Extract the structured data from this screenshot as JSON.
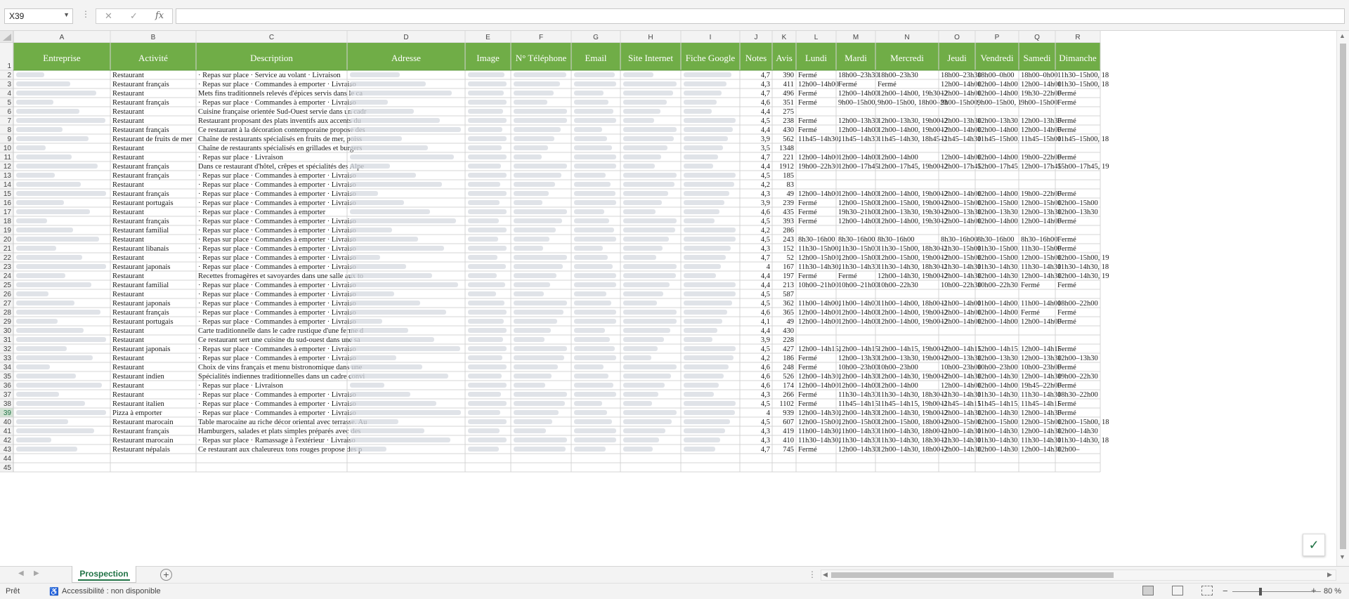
{
  "formula_bar": {
    "cell_ref": "X39",
    "formula": ""
  },
  "sheet": {
    "column_letters": [
      "A",
      "B",
      "C",
      "D",
      "E",
      "F",
      "G",
      "H",
      "I",
      "J",
      "K",
      "L",
      "M",
      "N",
      "O",
      "P",
      "Q",
      "R"
    ],
    "headers": [
      "Entreprise",
      "Activité",
      "Description",
      "Adresse",
      "Image",
      "N° Téléphone",
      "Email",
      "Site Internet",
      "Fiche Google",
      "Notes",
      "Avis",
      "Lundi",
      "Mardi",
      "Mercredi",
      "Jeudi",
      "Vendredi",
      "Samedi",
      "Dimanche"
    ],
    "header_fill": "#70ad47",
    "header_text_color": "#ffffff",
    "grid_color": "#d4d4d4",
    "row_heading_fill": "#f3f3f3",
    "selected_row": "39",
    "blurred_columns": [
      "A",
      "D",
      "E",
      "F",
      "G",
      "H",
      "I"
    ],
    "rows": [
      {
        "n": "2",
        "b": "Restaurant",
        "c": "·  Repas sur place  ·  Service au volant  ·  Livraison",
        "j": "4,7",
        "k": "390",
        "l": "Fermé",
        "m": "18h00–23h30",
        "nn": "18h00–23h30",
        "o": "18h00–23h30",
        "p": "18h00–0h00",
        "q": "18h00–0h00",
        "r": "11h30–15h00, 18"
      },
      {
        "n": "3",
        "b": "Restaurant français",
        "c": "·  Repas sur place  ·  Commandes à emporter  ·  Livraiso",
        "j": "4,3",
        "k": "411",
        "l": "12h00–14h00",
        "m": "Fermé",
        "nn": "Fermé",
        "o": "12h00–14h00",
        "p": "12h00–14h00",
        "q": "12h00–14h00",
        "r": "11h30–15h00, 18"
      },
      {
        "n": "4",
        "b": "Restaurant",
        "c": "Mets fins traditionnels relevés d'épices servis dans le ca",
        "j": "4,7",
        "k": "496",
        "l": "Fermé",
        "m": "12h00–14h00",
        "nn": "12h00–14h00, 19h30–2",
        "o": "12h00–14h00",
        "p": "12h00–14h00,",
        "q": "19h30–22h00",
        "r": "Fermé"
      },
      {
        "n": "5",
        "b": "Restaurant français",
        "c": "·  Repas sur place  ·  Commandes à emporter  ·  Livraiso",
        "j": "4,6",
        "k": "351",
        "l": "Fermé",
        "m": "9h00–15h00,",
        "nn": "9h00–15h00, 18h00–23",
        "o": "9h00–15h00,",
        "p": "9h00–15h00, 1",
        "q": "9h00–15h00",
        "r": "Fermé"
      },
      {
        "n": "6",
        "b": "Restaurant",
        "c": "Cuisine française orientée Sud-Ouest servie dans un cadr",
        "j": "4,4",
        "k": "275",
        "l": "",
        "m": "",
        "nn": "",
        "o": "",
        "p": "",
        "q": "",
        "r": ""
      },
      {
        "n": "7",
        "b": "Restaurant",
        "c": "Restaurant proposant des plats inventifs aux accents du",
        "j": "4,5",
        "k": "238",
        "l": "Fermé",
        "m": "12h00–13h30",
        "nn": "12h00–13h30, 19h00–2",
        "o": "12h00–13h30",
        "p": "12h00–13h30,",
        "q": "12h00–13h30",
        "r": "Fermé"
      },
      {
        "n": "8",
        "b": "Restaurant français",
        "c": "Ce restaurant à la décoration contemporaine propose des",
        "j": "4,4",
        "k": "430",
        "l": "Fermé",
        "m": "12h00–14h00",
        "nn": "12h00–14h00, 19h00–2",
        "o": "12h00–14h00",
        "p": "12h00–14h00,",
        "q": "12h00–14h00",
        "r": "Fermé"
      },
      {
        "n": "9",
        "b": "Restaurant de fruits de mer",
        "c": "Chaîne de restaurants spécialisés en fruits de mer, poiss",
        "j": "3,9",
        "k": "562",
        "l": "11h45–14h30,",
        "m": "11h45–14h30",
        "nn": "11h45–14h30, 18h45–2",
        "o": "11h45–14h30",
        "p": "11h45–15h00,",
        "q": "11h45–15h00",
        "r": "11h45–15h00, 18"
      },
      {
        "n": "10",
        "b": "Restaurant",
        "c": "Chaîne de restaurants spécialisés en grillades et burgers",
        "j": "3,5",
        "k": "1348",
        "l": "",
        "m": "",
        "nn": "",
        "o": "",
        "p": "",
        "q": "",
        "r": ""
      },
      {
        "n": "11",
        "b": "Restaurant",
        "c": "·  Repas sur place  ·  Livraison",
        "j": "4,7",
        "k": "221",
        "l": "12h00–14h00",
        "m": "12h00–14h00",
        "nn": "12h00–14h00",
        "o": "12h00–14h00",
        "p": "12h00–14h00,",
        "q": "19h00–22h00",
        "r": "Fermé"
      },
      {
        "n": "12",
        "b": "Restaurant français",
        "c": "Dans ce restaurant d'hôtel, crêpes et spécialités des Alpe",
        "j": "4,4",
        "k": "1912",
        "l": "19h00–22h30",
        "m": "12h00–17h45",
        "nn": "12h00–17h45, 19h00–2",
        "o": "12h00–17h45",
        "p": "12h00–17h45,",
        "q": "12h00–17h45",
        "r": "15h00–17h45, 19"
      },
      {
        "n": "13",
        "b": "Restaurant français",
        "c": "·  Repas sur place  ·  Commandes à emporter  ·  Livraiso",
        "j": "4,5",
        "k": "185",
        "l": "",
        "m": "",
        "nn": "",
        "o": "",
        "p": "",
        "q": "",
        "r": ""
      },
      {
        "n": "14",
        "b": "Restaurant",
        "c": "·  Repas sur place  ·  Commandes à emporter  ·  Livraiso",
        "j": "4,2",
        "k": "83",
        "l": "",
        "m": "",
        "nn": "",
        "o": "",
        "p": "",
        "q": "",
        "r": ""
      },
      {
        "n": "15",
        "b": "Restaurant français",
        "c": "·  Repas sur place  ·  Commandes à emporter  ·  Livraiso",
        "j": "4,3",
        "k": "49",
        "l": "12h00–14h00",
        "m": "12h00–14h00",
        "nn": "12h00–14h00, 19h00–2",
        "o": "12h00–14h00",
        "p": "12h00–14h00,",
        "q": "19h00–22h00",
        "r": "Fermé"
      },
      {
        "n": "16",
        "b": "Restaurant portugais",
        "c": "·  Repas sur place  ·  Commandes à emporter  ·  Livraiso",
        "j": "3,9",
        "k": "239",
        "l": "Fermé",
        "m": "12h00–15h00",
        "nn": "12h00–15h00, 19h00–2",
        "o": "12h00–15h00",
        "p": "12h00–15h00,",
        "q": "12h00–15h00",
        "r": "12h00–15h00"
      },
      {
        "n": "17",
        "b": "Restaurant",
        "c": "·  Repas sur place  ·  Commandes à emporter",
        "j": "4,6",
        "k": "435",
        "l": "Fermé",
        "m": "19h30–21h00",
        "nn": "12h00–13h30, 19h30–2",
        "o": "12h00–13h30",
        "p": "12h00–13h30,",
        "q": "12h00–13h30",
        "r": "12h00–13h30"
      },
      {
        "n": "18",
        "b": "Restaurant français",
        "c": "·  Repas sur place  ·  Commandes à emporter  ·  Livraiso",
        "j": "4,5",
        "k": "393",
        "l": "Fermé",
        "m": "12h00–14h00",
        "nn": "12h00–14h00, 19h30–2",
        "o": "12h00–14h00",
        "p": "12h00–14h00,",
        "q": "12h00–14h00",
        "r": "Fermé"
      },
      {
        "n": "19",
        "b": "Restaurant familial",
        "c": "·  Repas sur place  ·  Commandes à emporter  ·  Livraiso",
        "j": "4,2",
        "k": "286",
        "l": "",
        "m": "",
        "nn": "",
        "o": "",
        "p": "",
        "q": "",
        "r": ""
      },
      {
        "n": "20",
        "b": "Restaurant",
        "c": "·  Repas sur place  ·  Commandes à emporter  ·  Livraiso",
        "j": "4,5",
        "k": "243",
        "l": "8h30–16h00",
        "m": "8h30–16h00",
        "nn": "8h30–16h00",
        "o": "8h30–16h00",
        "p": "8h30–16h00",
        "q": "8h30–16h00",
        "r": "Fermé"
      },
      {
        "n": "21",
        "b": "Restaurant libanais",
        "c": "·  Repas sur place  ·  Commandes à emporter  ·  Livraiso",
        "j": "4,3",
        "k": "152",
        "l": "11h30–15h00,",
        "m": "11h30–15h00",
        "nn": "11h30–15h00, 18h30–2",
        "o": "11h30–15h00",
        "p": "11h30–15h00,",
        "q": "11h30–15h00",
        "r": "Fermé"
      },
      {
        "n": "22",
        "b": "Restaurant",
        "c": "·  Repas sur place  ·  Commandes à emporter  ·  Livraiso",
        "j": "4,7",
        "k": "52",
        "l": "12h00–15h00,",
        "m": "12h00–15h00",
        "nn": "12h00–15h00, 19h00–2",
        "o": "12h00–15h00",
        "p": "12h00–15h00,",
        "q": "12h00–15h00",
        "r": "12h00–15h00, 19"
      },
      {
        "n": "23",
        "b": "Restaurant japonais",
        "c": "·  Repas sur place  ·  Commandes à emporter  ·  Livraiso",
        "j": "4",
        "k": "167",
        "l": "11h30–14h30,",
        "m": "11h30–14h30",
        "nn": "11h30–14h30, 18h30–2",
        "o": "11h30–14h30",
        "p": "11h30–14h30,",
        "q": "11h30–14h30",
        "r": "11h30–14h30, 18"
      },
      {
        "n": "24",
        "b": "Restaurant",
        "c": "Recettes fromagères et savoyardes dans une salle aux to",
        "j": "4,4",
        "k": "197",
        "l": "Fermé",
        "m": "Fermé",
        "nn": "12h00–14h30, 19h00–2",
        "o": "12h00–14h30",
        "p": "12h00–14h30,",
        "q": "12h00–14h30",
        "r": "12h00–14h30, 19"
      },
      {
        "n": "25",
        "b": "Restaurant familial",
        "c": "·  Repas sur place  ·  Commandes à emporter  ·  Livraiso",
        "j": "4,4",
        "k": "213",
        "l": "10h00–21h00",
        "m": "10h00–21h00",
        "nn": "10h00–22h30",
        "o": "10h00–22h30",
        "p": "10h00–22h30",
        "q": "Fermé",
        "r": "Fermé"
      },
      {
        "n": "26",
        "b": "Restaurant",
        "c": "·  Repas sur place  ·  Commandes à emporter  ·  Livraiso",
        "j": "4,5",
        "k": "587",
        "l": "",
        "m": "",
        "nn": "",
        "o": "",
        "p": "",
        "q": "",
        "r": ""
      },
      {
        "n": "27",
        "b": "Restaurant japonais",
        "c": "·  Repas sur place  ·  Commandes à emporter  ·  Livraiso",
        "j": "4,5",
        "k": "362",
        "l": "11h00–14h00,",
        "m": "11h00–14h00",
        "nn": "11h00–14h00, 18h00–2",
        "o": "11h00–14h00",
        "p": "11h00–14h00,",
        "q": "11h00–14h00",
        "r": "18h00–22h00"
      },
      {
        "n": "28",
        "b": "Restaurant français",
        "c": "·  Repas sur place  ·  Commandes à emporter  ·  Livraiso",
        "j": "4,6",
        "k": "365",
        "l": "12h00–14h00",
        "m": "12h00–14h00",
        "nn": "12h00–14h00, 19h00–2",
        "o": "12h00–14h00",
        "p": "12h00–14h00,",
        "q": "Fermé",
        "r": "Fermé"
      },
      {
        "n": "29",
        "b": "Restaurant portugais",
        "c": "·  Repas sur place  ·  Commandes à emporter  ·  Livraiso",
        "j": "4,1",
        "k": "49",
        "l": "12h00–14h00",
        "m": "12h00–14h00",
        "nn": "12h00–14h00, 19h00–2",
        "o": "12h00–14h00",
        "p": "12h00–14h00,",
        "q": "12h00–14h00",
        "r": "Fermé"
      },
      {
        "n": "30",
        "b": "Restaurant",
        "c": "Carte traditionnelle dans le cadre rustique d'une ferme d",
        "j": "4,4",
        "k": "430",
        "l": "",
        "m": "",
        "nn": "",
        "o": "",
        "p": "",
        "q": "",
        "r": ""
      },
      {
        "n": "31",
        "b": "Restaurant",
        "c": "Ce restaurant sert une cuisine du sud-ouest dans une sa",
        "j": "3,9",
        "k": "228",
        "l": "",
        "m": "",
        "nn": "",
        "o": "",
        "p": "",
        "q": "",
        "r": ""
      },
      {
        "n": "32",
        "b": "Restaurant japonais",
        "c": "·  Repas sur place  ·  Commandes à emporter  ·  Livraiso",
        "j": "4,5",
        "k": "427",
        "l": "12h00–14h15,",
        "m": "12h00–14h15",
        "nn": "12h00–14h15, 19h00–2",
        "o": "12h00–14h15",
        "p": "12h00–14h15,",
        "q": "12h00–14h15",
        "r": "Fermé"
      },
      {
        "n": "33",
        "b": "Restaurant",
        "c": "·  Repas sur place  ·  Commandes à emporter  ·  Livraiso",
        "j": "4,2",
        "k": "186",
        "l": "Fermé",
        "m": "12h00–13h30",
        "nn": "12h00–13h30, 19h00–2",
        "o": "12h00–13h30",
        "p": "12h00–13h30,",
        "q": "12h00–13h30",
        "r": "12h00–13h30"
      },
      {
        "n": "34",
        "b": "Restaurant",
        "c": "Choix de vins français et menu bistronomique dans une",
        "j": "4,6",
        "k": "248",
        "l": "Fermé",
        "m": "10h00–23h00",
        "nn": "10h00–23h00",
        "o": "10h00–23h00",
        "p": "10h00–23h00",
        "q": "10h00–23h00",
        "r": "Fermé"
      },
      {
        "n": "35",
        "b": "Restaurant indien",
        "c": "Spécialités indiennes traditionnelles dans un cadre convi",
        "j": "4,6",
        "k": "526",
        "l": "12h00–14h30,",
        "m": "12h00–14h30",
        "nn": "12h00–14h30, 19h00–2",
        "o": "12h00–14h30",
        "p": "12h00–14h30,",
        "q": "12h00–14h30",
        "r": "19h00–22h30"
      },
      {
        "n": "36",
        "b": "Restaurant",
        "c": "·  Repas sur place  ·  Livraison",
        "j": "4,6",
        "k": "174",
        "l": "12h00–14h00",
        "m": "12h00–14h00",
        "nn": "12h00–14h00",
        "o": "12h00–14h00",
        "p": "12h00–14h00,",
        "q": "19h45–22h00",
        "r": "Fermé"
      },
      {
        "n": "37",
        "b": "Restaurant",
        "c": "·  Repas sur place  ·  Commandes à emporter  ·  Livraiso",
        "j": "4,3",
        "k": "266",
        "l": "Fermé",
        "m": "11h30–14h30",
        "nn": "11h30–14h30, 18h30–2",
        "o": "11h30–14h30",
        "p": "11h30–14h30,",
        "q": "11h30–14h30",
        "r": "18h30–22h00"
      },
      {
        "n": "38",
        "b": "Restaurant italien",
        "c": "·  Repas sur place  ·  Commandes à emporter  ·  Livraiso",
        "j": "4,5",
        "k": "1102",
        "l": "Fermé",
        "m": "11h45–14h15",
        "nn": "11h45–14h15, 19h00–2",
        "o": "11h45–14h15",
        "p": "11h45–14h15,",
        "q": "11h45–14h15",
        "r": "Fermé"
      },
      {
        "n": "39",
        "b": "Pizza à emporter",
        "c": "·  Repas sur place  ·  Commandes à emporter  ·  Livraiso",
        "j": "4",
        "k": "939",
        "l": "12h00–14h30,",
        "m": "12h00–14h30",
        "nn": "12h00–14h30, 19h00–2",
        "o": "12h00–14h30",
        "p": "12h00–14h30,",
        "q": "12h00–14h30",
        "r": "Fermé"
      },
      {
        "n": "40",
        "b": "Restaurant marocain",
        "c": "Table marocaine au riche décor oriental avec terrasse. Au",
        "j": "4,5",
        "k": "607",
        "l": "12h00–15h00,",
        "m": "12h00–15h00",
        "nn": "12h00–15h00, 18h00–2",
        "o": "12h00–15h00",
        "p": "12h00–15h00,",
        "q": "12h00–15h00",
        "r": "12h00–15h00, 18"
      },
      {
        "n": "41",
        "b": "Restaurant français",
        "c": "Hamburgers, salades et plats simples préparés avec des",
        "j": "4,3",
        "k": "419",
        "l": "11h00–14h30,",
        "m": "11h00–14h30",
        "nn": "11h00–14h30, 18h00–2",
        "o": "11h00–14h30",
        "p": "11h00–14h30,",
        "q": "12h00–14h30",
        "r": "12h00–14h30"
      },
      {
        "n": "42",
        "b": "Restaurant marocain",
        "c": "·  Repas sur place  ·  Ramassage à l'extérieur  ·  Livraiso",
        "j": "4,3",
        "k": "410",
        "l": "11h30–14h30,",
        "m": "11h30–14h30",
        "nn": "11h30–14h30, 18h30–2",
        "o": "11h30–14h30",
        "p": "11h30–14h30,",
        "q": "11h30–14h30",
        "r": "11h30–14h30, 18"
      },
      {
        "n": "43",
        "b": "Restaurant népalais",
        "c": "Ce restaurant aux chaleureux tons rouges propose des p",
        "j": "4,7",
        "k": "745",
        "l": "Fermé",
        "m": "12h00–14h30",
        "nn": "12h00–14h30, 18h00–2",
        "o": "12h00–14h30",
        "p": "12h00–14h30,",
        "q": "12h00–14h30",
        "r": "12h00–"
      },
      {
        "n": "44",
        "b": "",
        "c": "",
        "j": "",
        "k": "",
        "l": "",
        "m": "",
        "nn": "",
        "o": "",
        "p": "",
        "q": "",
        "r": ""
      },
      {
        "n": "45",
        "b": "",
        "c": "",
        "j": "",
        "k": "",
        "l": "",
        "m": "",
        "nn": "",
        "o": "",
        "p": "",
        "q": "",
        "r": ""
      }
    ]
  },
  "tabs": {
    "active": "Prospection",
    "add_icon": "plus-circle-icon"
  },
  "status": {
    "ready": "Prêt",
    "accessibility": "Accessibilité : non disponible",
    "zoom": "80 %"
  }
}
